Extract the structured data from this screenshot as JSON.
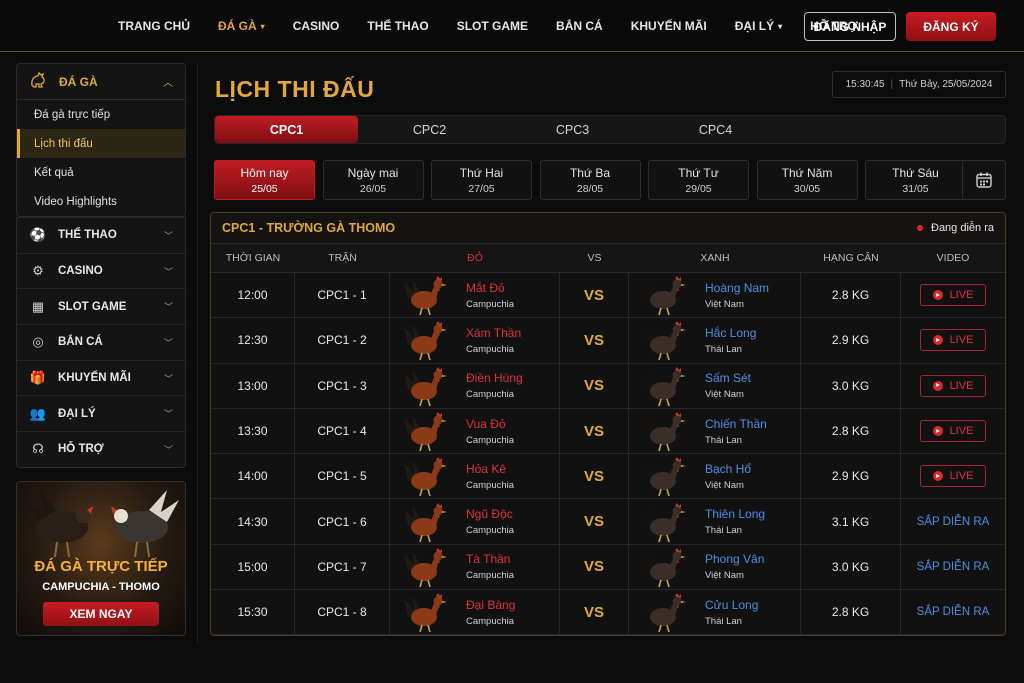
{
  "nav": {
    "items": [
      {
        "label": "TRANG CHỦ",
        "active": false,
        "dropdown": false
      },
      {
        "label": "ĐÁ GÀ",
        "active": true,
        "dropdown": true
      },
      {
        "label": "CASINO",
        "active": false,
        "dropdown": false
      },
      {
        "label": "THỂ THAO",
        "active": false,
        "dropdown": false
      },
      {
        "label": "SLOT GAME",
        "active": false,
        "dropdown": false
      },
      {
        "label": "BẮN CÁ",
        "active": false,
        "dropdown": false
      },
      {
        "label": "KHUYẾN MÃI",
        "active": false,
        "dropdown": false
      },
      {
        "label": "ĐẠI LÝ",
        "active": false,
        "dropdown": true
      },
      {
        "label": "HỖ TRỢ",
        "active": false,
        "dropdown": false
      }
    ],
    "login_label": "ĐĂNG NHẬP",
    "register_label": "ĐĂNG KÝ"
  },
  "sidebar": {
    "section": {
      "label": "ĐÁ GÀ",
      "icon": "rooster-icon"
    },
    "sub_items": [
      {
        "label": "Đá gà trực tiếp",
        "active": false
      },
      {
        "label": "Lịch thi đấu",
        "active": true
      },
      {
        "label": "Kết quả",
        "active": false
      },
      {
        "label": "Video Highlights",
        "active": false
      }
    ],
    "menu": [
      {
        "label": "THỂ THAO",
        "icon": "soccer-ball-icon",
        "glyph": "⚽"
      },
      {
        "label": "CASINO",
        "icon": "casino-chip-icon",
        "glyph": "⚙"
      },
      {
        "label": "SLOT GAME",
        "icon": "slot-machine-icon",
        "glyph": "▦"
      },
      {
        "label": "BẮN CÁ",
        "icon": "fish-icon",
        "glyph": "◎"
      },
      {
        "label": "KHUYẾN MÃI",
        "icon": "gift-icon",
        "glyph": "🎁"
      },
      {
        "label": "ĐẠI LÝ",
        "icon": "users-icon",
        "glyph": "👥"
      },
      {
        "label": "HỖ TRỢ",
        "icon": "headset-icon",
        "glyph": "☊"
      }
    ],
    "promo": {
      "title": "ĐÁ GÀ TRỰC TIẾP",
      "subtitle": "CAMPUCHIA - THOMO",
      "button": "XEM NGAY"
    }
  },
  "main": {
    "title": "LỊCH THI ĐẤU",
    "clock": {
      "time": "15:30:45",
      "date": "Thứ Bảy, 25/05/2024"
    },
    "tabs": [
      {
        "label": "CPC1",
        "active": true
      },
      {
        "label": "CPC2",
        "active": false
      },
      {
        "label": "CPC3",
        "active": false
      },
      {
        "label": "CPC4",
        "active": false
      }
    ],
    "days": [
      {
        "name": "Hôm nay",
        "date": "25/05",
        "active": true
      },
      {
        "name": "Ngày mai",
        "date": "26/05",
        "active": false
      },
      {
        "name": "Thứ Hai",
        "date": "27/05",
        "active": false
      },
      {
        "name": "Thứ Ba",
        "date": "28/05",
        "active": false
      },
      {
        "name": "Thứ Tư",
        "date": "29/05",
        "active": false
      },
      {
        "name": "Thứ Năm",
        "date": "30/05",
        "active": false
      },
      {
        "name": "Thứ Sáu",
        "date": "31/05",
        "active": false
      }
    ],
    "table": {
      "title": "CPC1 - TRƯỜNG GÀ THOMO",
      "status": "Đang diễn ra",
      "headers": [
        "THỜI GIAN",
        "TRẬN",
        "ĐỎ",
        "VS",
        "XANH",
        "HẠNG CÂN",
        "VIDEO"
      ],
      "vs_label": "VS",
      "rows": [
        {
          "time": "12:00",
          "match": "CPC1 - 1",
          "red": "Mắt Đỏ",
          "red_country": "Campuchia",
          "blue": "Hoàng Nam",
          "blue_country": "Việt Nam",
          "weight": "2.8 KG",
          "video": "LIVE",
          "live": true
        },
        {
          "time": "12:30",
          "match": "CPC1 - 2",
          "red": "Xám Thần",
          "red_country": "Campuchia",
          "blue": "Hắc Long",
          "blue_country": "Thái Lan",
          "weight": "2.9 KG",
          "video": "LIVE",
          "live": true
        },
        {
          "time": "13:00",
          "match": "CPC1 - 3",
          "red": "Điền Hùng",
          "red_country": "Campuchia",
          "blue": "Sấm Sét",
          "blue_country": "Việt Nam",
          "weight": "3.0 KG",
          "video": "LIVE",
          "live": true
        },
        {
          "time": "13:30",
          "match": "CPC1 - 4",
          "red": "Vua Đỏ",
          "red_country": "Campuchia",
          "blue": "Chiến Thần",
          "blue_country": "Thái Lan",
          "weight": "2.8 KG",
          "video": "LIVE",
          "live": true
        },
        {
          "time": "14:00",
          "match": "CPC1 - 5",
          "red": "Hỏa Kê",
          "red_country": "Campuchia",
          "blue": "Bạch Hổ",
          "blue_country": "Việt Nam",
          "weight": "2.9 KG",
          "video": "LIVE",
          "live": true
        },
        {
          "time": "14:30",
          "match": "CPC1 - 6",
          "red": "Ngũ Độc",
          "red_country": "Campuchia",
          "blue": "Thiên Long",
          "blue_country": "Thái Lan",
          "weight": "3.1 KG",
          "video": "SẮP DIỄN RA",
          "live": false
        },
        {
          "time": "15:00",
          "match": "CPC1 - 7",
          "red": "Tà Thần",
          "red_country": "Campuchia",
          "blue": "Phong Vân",
          "blue_country": "Việt Nam",
          "weight": "3.0 KG",
          "video": "SẮP DIỄN RA",
          "live": false
        },
        {
          "time": "15:30",
          "match": "CPC1 - 8",
          "red": "Đại Bàng",
          "red_country": "Campuchia",
          "blue": "Cửu Long",
          "blue_country": "Thái Lan",
          "weight": "2.8 KG",
          "video": "SẮP DIỄN RA",
          "live": false
        }
      ]
    }
  },
  "colors": {
    "gold": "#e2a83a",
    "red": "#c81c22",
    "blue": "#4d8fe0",
    "background": "#0c0c0d"
  }
}
